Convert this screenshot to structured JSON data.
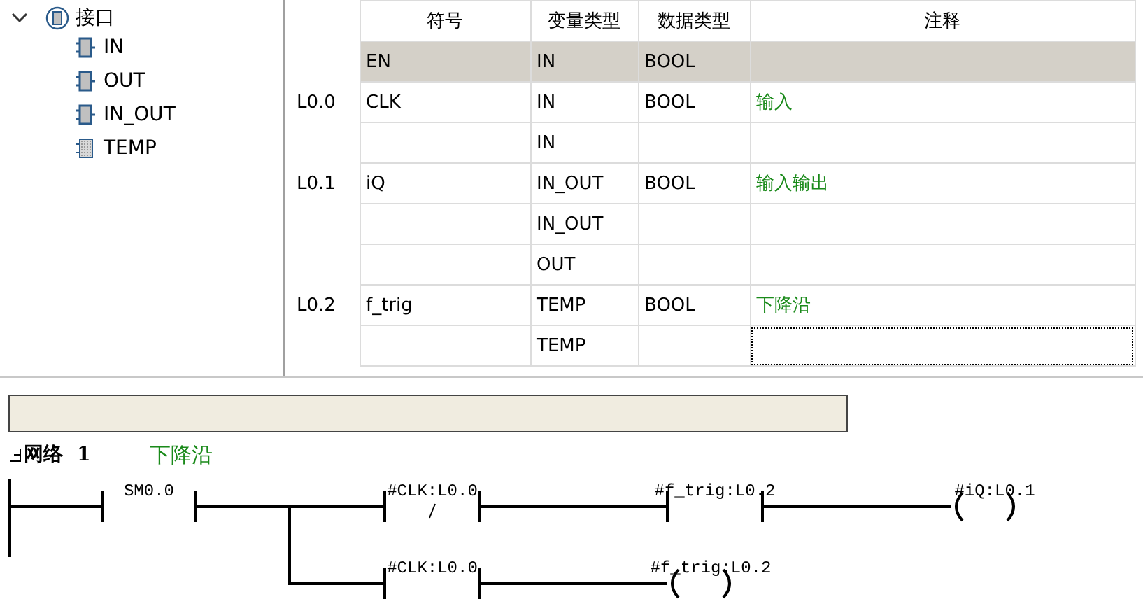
{
  "interface_tree": {
    "label": "接口",
    "expanded": true,
    "children": [
      {
        "label": "IN",
        "kind": "param"
      },
      {
        "label": "OUT",
        "kind": "param"
      },
      {
        "label": "IN_OUT",
        "kind": "param"
      },
      {
        "label": "TEMP",
        "kind": "temp"
      }
    ]
  },
  "table": {
    "columns": [
      "符号",
      "变量类型",
      "数据类型",
      "注释"
    ],
    "rows": [
      {
        "address": "",
        "symbol": "EN",
        "var_type": "IN",
        "data_type": "BOOL",
        "comment": "",
        "selected": true,
        "focused": false
      },
      {
        "address": "L0.0",
        "symbol": "CLK",
        "var_type": "IN",
        "data_type": "BOOL",
        "comment": "输入",
        "selected": false,
        "focused": false
      },
      {
        "address": "",
        "symbol": "",
        "var_type": "IN",
        "data_type": "",
        "comment": "",
        "selected": false,
        "focused": false
      },
      {
        "address": "L0.1",
        "symbol": "iQ",
        "var_type": "IN_OUT",
        "data_type": "BOOL",
        "comment": "输入输出",
        "selected": false,
        "focused": false
      },
      {
        "address": "",
        "symbol": "",
        "var_type": "IN_OUT",
        "data_type": "",
        "comment": "",
        "selected": false,
        "focused": false
      },
      {
        "address": "",
        "symbol": "",
        "var_type": "OUT",
        "data_type": "",
        "comment": "",
        "selected": false,
        "focused": false
      },
      {
        "address": "L0.2",
        "symbol": "f_trig",
        "var_type": "TEMP",
        "data_type": "BOOL",
        "comment": "下降沿",
        "selected": false,
        "focused": false
      },
      {
        "address": "",
        "symbol": "",
        "var_type": "TEMP",
        "data_type": "",
        "comment": "",
        "selected": false,
        "focused": true
      }
    ]
  },
  "network": {
    "title": "网络",
    "number": "1",
    "comment": "下降沿",
    "main": [
      {
        "kind": "contact_no",
        "label": "SM0.0"
      },
      {
        "kind": "contact_nc",
        "label": "#CLK:L0.0"
      },
      {
        "kind": "contact_no",
        "label": "#f_trig:L0.2"
      },
      {
        "kind": "coil",
        "label": "#iQ:L0.1"
      }
    ],
    "branch": [
      {
        "kind": "contact_no",
        "label": "#CLK:L0.0"
      },
      {
        "kind": "coil",
        "label": "#f_trig:L0.2"
      }
    ]
  }
}
